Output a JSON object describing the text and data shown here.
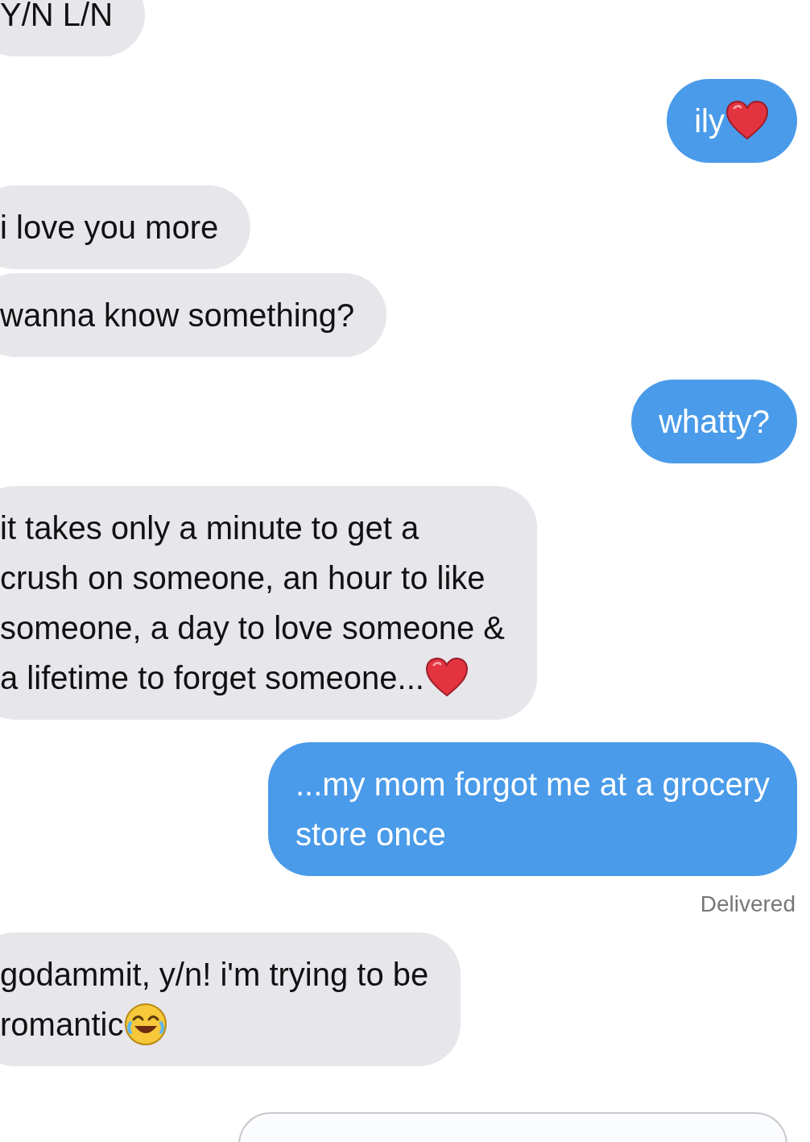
{
  "messages": [
    {
      "kind": "received",
      "text": "Y/N L/N"
    },
    {
      "kind": "sent",
      "text": "ily",
      "trailing_icon": {
        "kind": "heart"
      }
    },
    {
      "kind": "received",
      "text": "i love you more"
    },
    {
      "kind": "received",
      "text": "wanna know something?"
    },
    {
      "kind": "sent",
      "text": "whatty?"
    },
    {
      "kind": "received",
      "text": "it takes only a minute to get a\ncrush on someone, an hour to like\nsomeone, a day to love someone &\na lifetime to forget someone...",
      "trailing_icon": {
        "kind": "heart"
      }
    },
    {
      "kind": "sent",
      "text": "...my mom forgot me at a grocery\nstore once"
    },
    {
      "kind": "status",
      "text": "Delivered"
    },
    {
      "kind": "received",
      "text": "godammit, y/n!  i'm trying to be\nromantic",
      "trailing_icon": {
        "kind": "laugh"
      }
    }
  ],
  "composer": {
    "kind": "field"
  }
}
